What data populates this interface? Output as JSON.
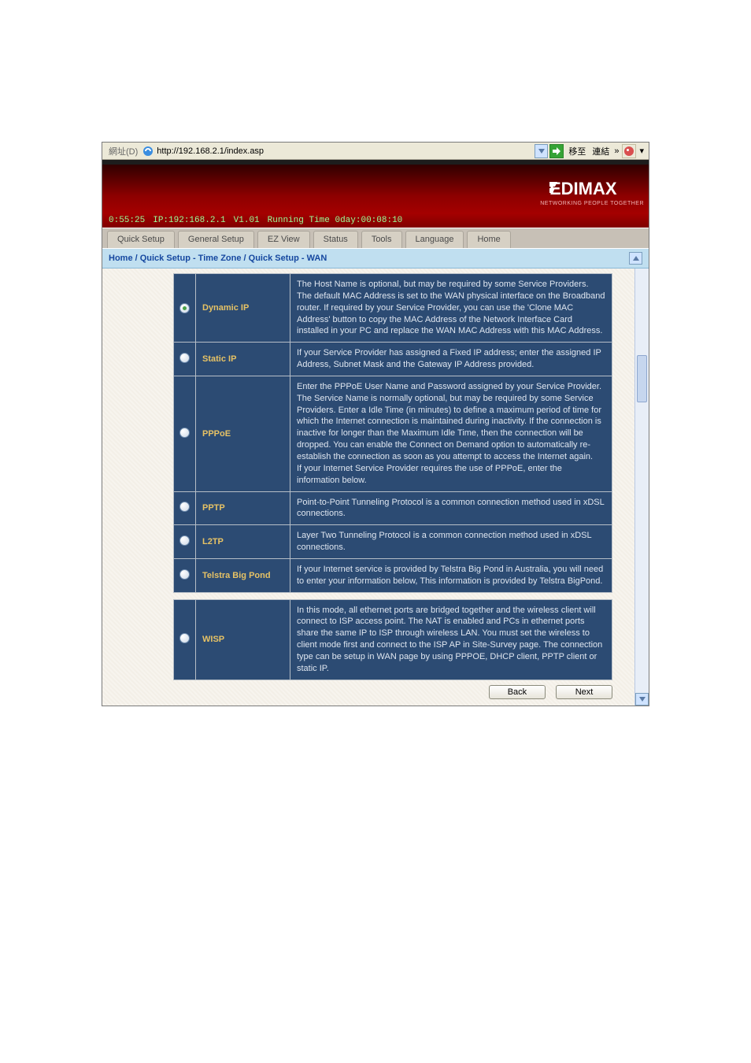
{
  "addressbar": {
    "label": "網址(D)",
    "url": "http://192.168.2.1/index.asp",
    "go_label": "移至",
    "links_label": "連結"
  },
  "brand": {
    "name": "EDIMAX",
    "sub": "NETWORKING PEOPLE TOGETHER"
  },
  "statusline": {
    "uptime": "0:55:25",
    "ip": "IP:192:168.2.1",
    "ver": "V1.01",
    "running": "Running Time 0day:00:08:10"
  },
  "tabs": {
    "items": [
      {
        "label": "Quick Setup"
      },
      {
        "label": "General Setup"
      },
      {
        "label": "EZ View"
      },
      {
        "label": "Status"
      },
      {
        "label": "Tools"
      },
      {
        "label": "Language"
      },
      {
        "label": "Home"
      }
    ]
  },
  "breadcrumb": {
    "text": "Home / Quick Setup - Time Zone / Quick Setup - WAN"
  },
  "wan": {
    "options": [
      {
        "key": "dynamic_ip",
        "name": "Dynamic IP",
        "checked": true,
        "desc": "The Host Name is optional, but may be required by some Service Providers. The default MAC Address is set to the WAN physical interface on the Broadband router. If required by your Service Provider, you can use the 'Clone MAC Address' button to copy the MAC Address of the Network Interface Card installed in your PC and replace the WAN MAC Address with this MAC Address."
      },
      {
        "key": "static_ip",
        "name": "Static IP",
        "checked": false,
        "desc": "If your Service Provider has assigned a Fixed IP address; enter the assigned IP Address, Subnet Mask and the Gateway IP Address provided."
      },
      {
        "key": "pppoe",
        "name": "PPPoE",
        "checked": false,
        "desc": "Enter the PPPoE User Name and Password assigned by your Service Provider. The Service Name is normally optional, but may be required by some Service Providers. Enter a Idle Time (in minutes) to define a maximum period of time for which the Internet connection is maintained during inactivity. If the connection is inactive for longer than the Maximum Idle Time, then the connection will be dropped. You can enable the Connect on Demand option to automatically re-establish the connection as soon as you attempt to access the Internet again.\nIf your Internet Service Provider requires the use of PPPoE, enter the information below."
      },
      {
        "key": "pptp",
        "name": "PPTP",
        "checked": false,
        "desc": "Point-to-Point Tunneling Protocol is a common connection method used in xDSL connections."
      },
      {
        "key": "l2tp",
        "name": "L2TP",
        "checked": false,
        "desc": "Layer Two Tunneling Protocol is a common connection method used in xDSL connections."
      },
      {
        "key": "telstra",
        "name": "Telstra Big Pond",
        "checked": false,
        "desc": "If your Internet service is provided by Telstra Big Pond in Australia, you will need to enter your information below, This information is provided by Telstra BigPond."
      }
    ],
    "wisp": {
      "key": "wisp",
      "name": "WISP",
      "checked": false,
      "desc": "In this mode, all ethernet ports are bridged together and the wireless client will connect to ISP access point. The NAT is enabled and PCs in ethernet ports share the same IP to ISP through wireless LAN. You must set the wireless to client mode first and connect to the ISP AP in Site-Survey page. The connection type can be setup in WAN page by using PPPOE, DHCP client, PPTP client or static IP."
    }
  },
  "buttons": {
    "back": "Back",
    "next": "Next"
  }
}
